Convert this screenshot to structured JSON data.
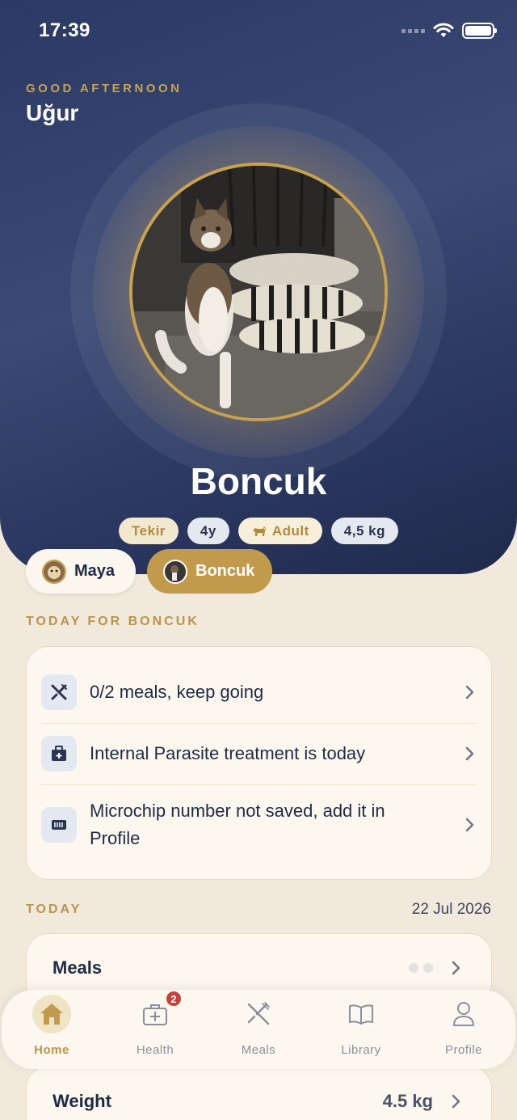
{
  "status": {
    "time": "17:39"
  },
  "header": {
    "greeting": "GOOD AFTERNOON",
    "user_name": "Uğur"
  },
  "pet": {
    "name": "Boncuk",
    "tags": [
      {
        "label": "Tekir"
      },
      {
        "label": "4y"
      },
      {
        "label": "Adult",
        "icon": "dog-icon"
      },
      {
        "label": "4,5 kg"
      }
    ]
  },
  "pet_switcher": [
    {
      "name": "Maya",
      "selected": false
    },
    {
      "name": "Boncuk",
      "selected": true
    }
  ],
  "today_for": {
    "title": "TODAY FOR BONCUK",
    "items": [
      {
        "icon": "utensils-icon",
        "text": "0/2 meals, keep going"
      },
      {
        "icon": "medical-kit-icon",
        "text": "Internal Parasite treatment is today"
      },
      {
        "icon": "microchip-icon",
        "text": "Microchip number not saved, add it in Profile"
      }
    ]
  },
  "today": {
    "title": "TODAY",
    "date": "22 Jul 2026",
    "meals_label": "Meals",
    "weight_label": "Weight",
    "weight_value": "4.5 kg"
  },
  "tabbar": {
    "tabs": [
      {
        "label": "Home",
        "icon": "home-icon",
        "active": true
      },
      {
        "label": "Health",
        "icon": "health-icon",
        "badge": "2"
      },
      {
        "label": "Meals",
        "icon": "meals-icon"
      },
      {
        "label": "Library",
        "icon": "book-icon"
      },
      {
        "label": "Profile",
        "icon": "person-icon"
      }
    ]
  },
  "colors": {
    "accent": "#c29a4c",
    "hero": "#2b3a64",
    "background": "#f1e9dc",
    "badge": "#c4423a"
  }
}
